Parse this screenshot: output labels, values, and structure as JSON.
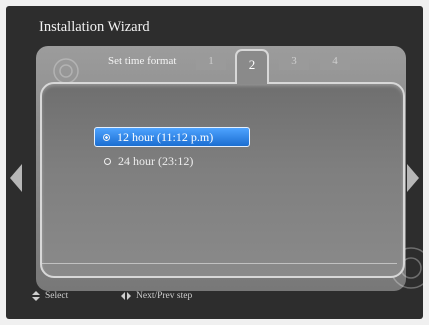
{
  "window": {
    "title": "Installation Wizard"
  },
  "wizard": {
    "step_label": "Set time format",
    "steps": [
      "1",
      "2",
      "3",
      "4"
    ],
    "active_step": "2"
  },
  "options": [
    {
      "label": "12 hour (11:12 p.m)",
      "selected": true
    },
    {
      "label": "24 hour (23:12)",
      "selected": false
    }
  ],
  "footer": {
    "select_label": "Select",
    "nav_label": "Next/Prev step"
  },
  "icons": {
    "select": "up-down-arrows-icon",
    "nav": "left-right-arrows-icon",
    "prev": "arrow-left-icon",
    "next": "arrow-right-icon"
  },
  "colors": {
    "background": "#2d2d2d",
    "highlight": "#2a86e8"
  }
}
